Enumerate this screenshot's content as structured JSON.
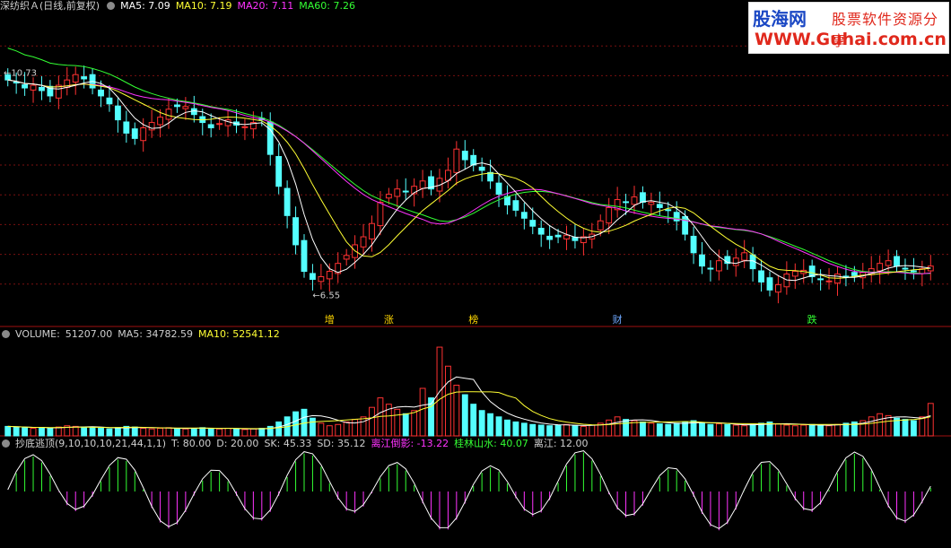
{
  "main_header": {
    "title": "深纺织Ａ(日线,前复权)",
    "items": [
      {
        "label": "MA5:",
        "value": "7.09",
        "color": "#ffffff"
      },
      {
        "label": "MA10:",
        "value": "7.19",
        "color": "#ffff33"
      },
      {
        "label": "MA20:",
        "value": "7.11",
        "color": "#ff33ff"
      },
      {
        "label": "MA60:",
        "value": "7.26",
        "color": "#33ff33"
      }
    ]
  },
  "volume_header": {
    "title": "VOLUME:",
    "items": [
      {
        "label": "",
        "value": "51207.00",
        "color": "#cfcfcf"
      },
      {
        "label": "MA5:",
        "value": "34782.59",
        "color": "#cfcfcf"
      },
      {
        "label": "MA10:",
        "value": "52541.12",
        "color": "#ffff33"
      }
    ]
  },
  "indicator_header": {
    "title": "抄底逃顶(9,10,10,10,21,44,1,1)",
    "items": [
      {
        "label": "T:",
        "value": "80.00",
        "color": "#cfcfcf"
      },
      {
        "label": "D:",
        "value": "20.00",
        "color": "#cfcfcf"
      },
      {
        "label": "SK:",
        "value": "45.33",
        "color": "#cfcfcf"
      },
      {
        "label": "SD:",
        "value": "35.12",
        "color": "#cfcfcf"
      },
      {
        "label": "离江倒影:",
        "value": "-13.22",
        "color": "#ff33ff"
      },
      {
        "label": "桂林山水:",
        "value": "40.07",
        "color": "#33ff33"
      },
      {
        "label": "离江:",
        "value": "12.00",
        "color": "#cfcfcf"
      }
    ]
  },
  "watermark": {
    "line1": "股海网",
    "line2": "股票软件资源分享",
    "line3": "WWW.Guhai.com.cn"
  },
  "colors": {
    "up": "#ff3232",
    "down": "#54ffff",
    "ma5": "#ffffff",
    "ma10": "#ffff33",
    "ma20": "#ff33ff",
    "ma60": "#33ff33",
    "grid": "#7a1010",
    "text": "#cfcfcf",
    "label": "#ffd700"
  },
  "chart_data": [
    {
      "type": "candlestick",
      "ylim": [
        6.2,
        11.8
      ],
      "annotations": [
        {
          "text": "10.73",
          "value": 10.73
        },
        {
          "text": "6.55",
          "value": 6.55
        }
      ],
      "markers": [
        "增",
        "涨",
        "榜",
        "财",
        "跌"
      ],
      "closes": [
        10.6,
        10.55,
        10.45,
        10.5,
        10.4,
        10.3,
        10.5,
        10.6,
        10.7,
        10.62,
        10.45,
        10.3,
        10.15,
        9.85,
        9.6,
        9.5,
        9.7,
        9.8,
        9.9,
        10.05,
        10.1,
        10.1,
        9.95,
        9.8,
        9.7,
        9.78,
        9.85,
        9.75,
        9.72,
        9.8,
        9.85,
        9.2,
        8.6,
        8.05,
        7.5,
        7.0,
        6.85,
        6.9,
        7.0,
        7.15,
        7.3,
        7.5,
        7.65,
        7.9,
        8.3,
        8.45,
        8.55,
        8.5,
        8.6,
        8.7,
        8.55,
        8.75,
        8.9,
        9.3,
        9.1,
        9.0,
        8.9,
        8.7,
        8.45,
        8.25,
        8.15,
        8.0,
        7.85,
        7.7,
        7.6,
        7.65,
        7.68,
        7.58,
        7.65,
        7.7,
        7.95,
        8.2,
        8.35,
        8.3,
        8.4,
        8.3,
        8.3,
        8.2,
        8.15,
        7.95,
        7.7,
        7.35,
        7.1,
        7.05,
        7.2,
        7.15,
        7.25,
        7.35,
        7.05,
        6.8,
        6.65,
        6.75,
        6.95,
        7.0,
        7.02,
        6.9,
        6.85,
        6.82,
        6.95,
        6.9,
        6.92,
        6.98,
        7.05,
        7.15,
        7.2,
        7.1,
        7.05,
        7.0,
        7.05,
        7.1
      ],
      "volumes": [
        15000,
        14000,
        13000,
        12000,
        13000,
        12000,
        14000,
        16000,
        15000,
        14000,
        13000,
        12000,
        11000,
        13000,
        15000,
        14000,
        12000,
        11000,
        12000,
        13000,
        12000,
        11000,
        12000,
        13000,
        12000,
        11000,
        12000,
        11000,
        10000,
        11000,
        12000,
        15000,
        22000,
        30000,
        38000,
        42000,
        28000,
        20000,
        16000,
        18000,
        22000,
        26000,
        30000,
        45000,
        60000,
        50000,
        42000,
        35000,
        40000,
        75000,
        60000,
        140000,
        110000,
        80000,
        65000,
        50000,
        40000,
        35000,
        30000,
        25000,
        22000,
        20000,
        18000,
        17000,
        16000,
        17000,
        18000,
        16000,
        15000,
        17000,
        20000,
        25000,
        30000,
        26000,
        24000,
        22000,
        20000,
        19000,
        18000,
        20000,
        22000,
        24000,
        20000,
        18000,
        19000,
        18000,
        17000,
        16000,
        18000,
        20000,
        22000,
        19000,
        17000,
        16000,
        17000,
        18000,
        17000,
        16000,
        18000,
        20000,
        22000,
        24000,
        30000,
        35000,
        32000,
        28000,
        26000,
        24000,
        30000,
        51207
      ]
    },
    {
      "type": "oscillator",
      "ylim": [
        -60,
        60
      ],
      "series": [
        {
          "name": "离江倒影",
          "color": "#ff33ff"
        },
        {
          "name": "桂林山水",
          "color": "#33ff33"
        }
      ]
    }
  ]
}
